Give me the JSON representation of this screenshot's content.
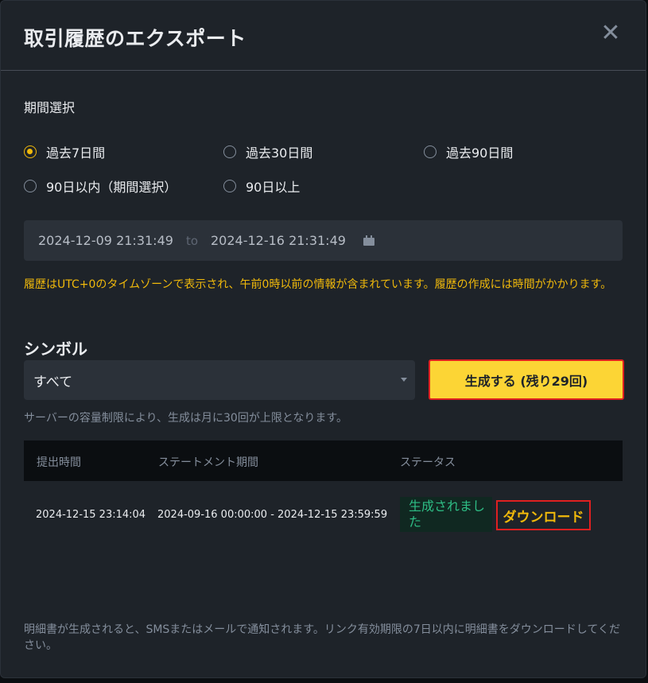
{
  "dialog": {
    "title": "取引履歴のエクスポート",
    "close_label": "✕"
  },
  "period": {
    "label": "期間選択",
    "options": [
      {
        "label": "過去7日間",
        "checked": true
      },
      {
        "label": "過去30日間",
        "checked": false
      },
      {
        "label": "過去90日間",
        "checked": false
      },
      {
        "label": "90日以内（期間選択）",
        "checked": false
      },
      {
        "label": "90日以上",
        "checked": false
      }
    ],
    "start": "2024-12-09 21:31:49",
    "separator": "to",
    "end": "2024-12-16 21:31:49"
  },
  "warning": "履歴はUTC+0のタイムゾーンで表示され、午前0時以前の情報が含まれています。履歴の作成には時間がかかります。",
  "symbol": {
    "label": "シンボル",
    "selected": "すべて"
  },
  "generate_button": "生成する (残り29回)",
  "limit_note": "サーバーの容量制限により、生成は月に30回が上限となります。",
  "table": {
    "columns": [
      "提出時間",
      "ステートメント期間",
      "ステータス"
    ],
    "rows": [
      {
        "submitted": "2024-12-15 23:14:04",
        "period": "2024-09-16 00:00:00 - 2024-12-15 23:59:59",
        "status": "生成されました",
        "action": "ダウンロード"
      }
    ]
  },
  "footer_note": "明細書が生成されると、SMSまたはメールで通知されます。リンク有効期限の7日以内に明細書をダウンロードしてください。",
  "colors": {
    "accent": "#f0b90b",
    "button": "#fcd535",
    "success": "#2ebd85",
    "highlight_border": "#e02020"
  }
}
